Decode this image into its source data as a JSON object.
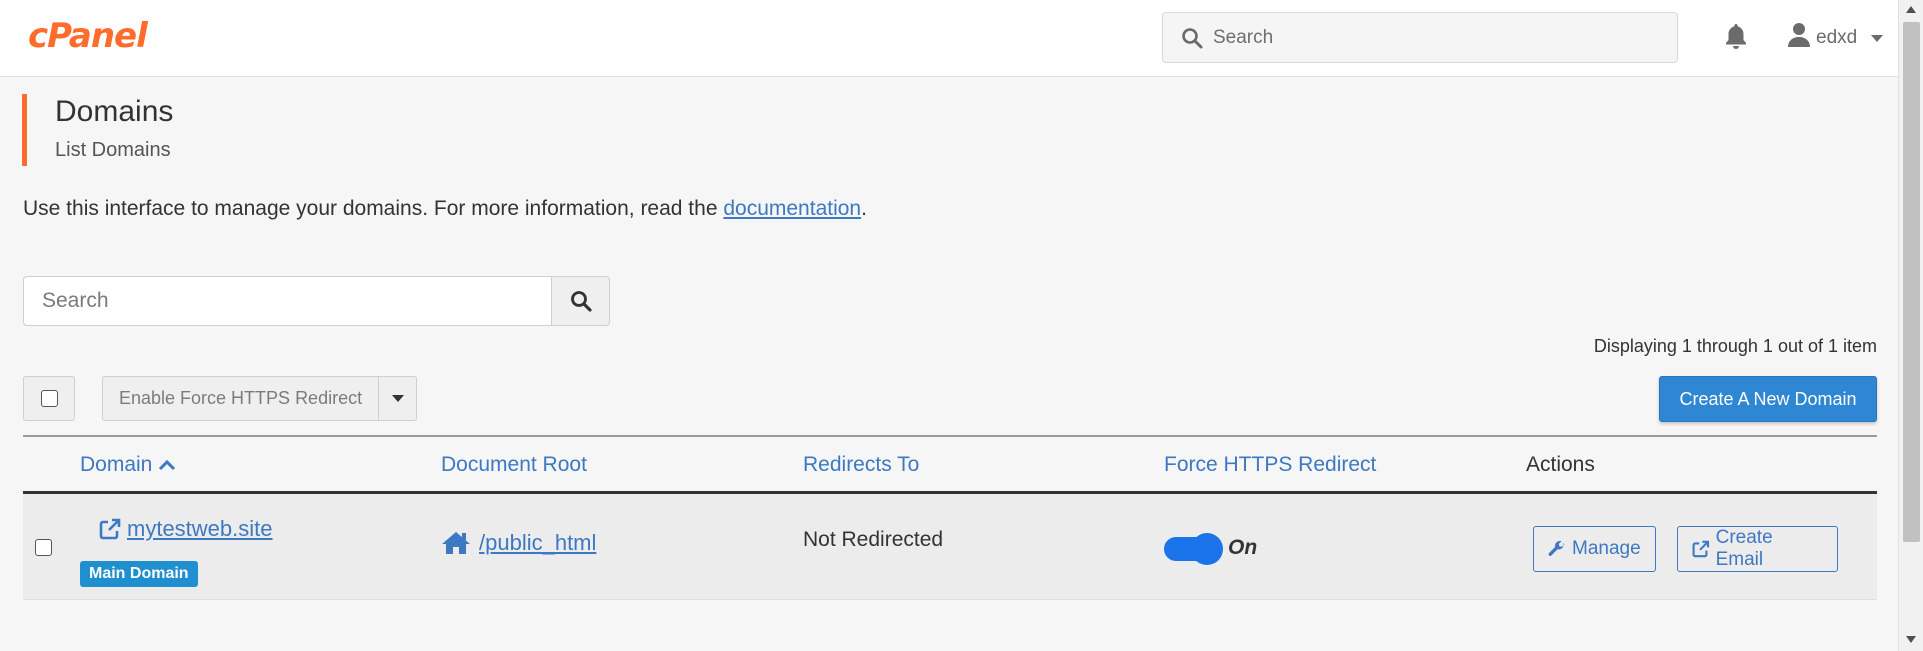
{
  "header": {
    "logo": "cPanel",
    "search_placeholder": "Search",
    "username": "edxd"
  },
  "page": {
    "title": "Domains",
    "subtitle": "List Domains",
    "intro_text": "Use this interface to manage your domains. For more information, read the ",
    "intro_link": "documentation",
    "intro_end": "."
  },
  "table_search": {
    "placeholder": "Search"
  },
  "displaying": "Displaying 1 through 1 out of 1 item",
  "toolbar": {
    "bulk_action": "Enable Force HTTPS Redirect",
    "create_button": "Create A New Domain"
  },
  "columns": {
    "domain": "Domain",
    "document_root": "Document Root",
    "redirects_to": "Redirects To",
    "force_https": "Force HTTPS Redirect",
    "actions": "Actions"
  },
  "rows": [
    {
      "domain": "mytestweb.site",
      "badge": "Main Domain",
      "document_root": "/public_html",
      "redirects_to": "Not Redirected",
      "force_https": true,
      "force_https_label": "On",
      "manage_label": "Manage",
      "email_label": "Create Email"
    }
  ],
  "colors": {
    "brand": "#ff6c2c",
    "link": "#3d78c3",
    "primary_button": "#2f86d3",
    "toggle_on": "#1a73e8",
    "badge": "#1f8fd0"
  }
}
